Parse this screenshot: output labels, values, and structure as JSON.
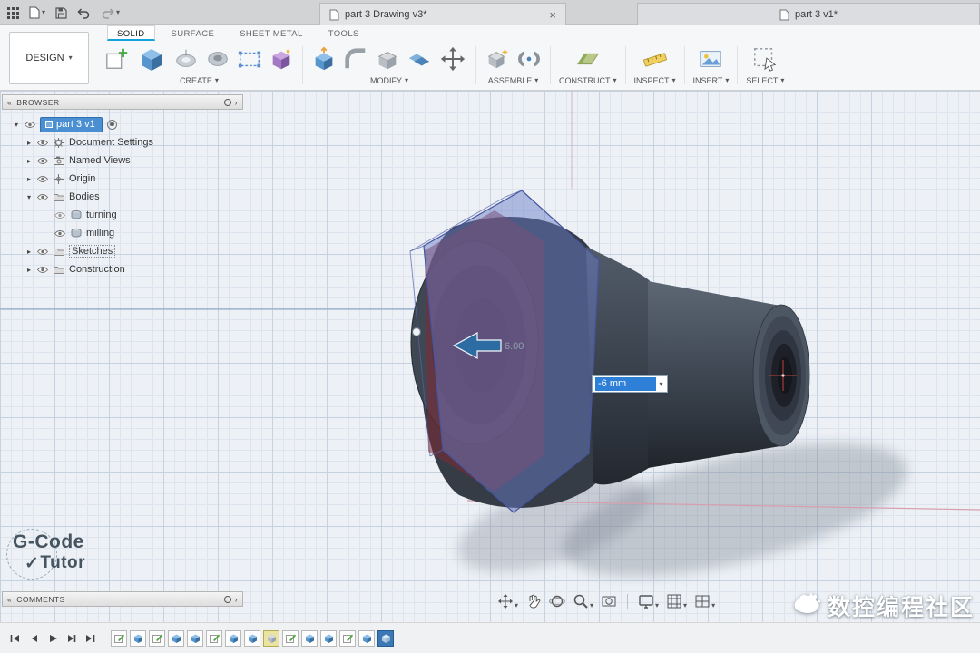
{
  "icons": {
    "caret_down": "▾",
    "tri_right": "▸",
    "tri_down": "▾",
    "close": "×",
    "chevrons_left": "«",
    "chevron_right": "›",
    "check": "✓"
  },
  "titlebar": {
    "tabs": [
      {
        "label": "part 3 Drawing v3*"
      },
      {
        "label": "part 3 v1*"
      }
    ]
  },
  "ribbon": {
    "design_menu": "DESIGN",
    "tabs": [
      {
        "label": "SOLID"
      },
      {
        "label": "SURFACE"
      },
      {
        "label": "SHEET METAL"
      },
      {
        "label": "TOOLS"
      }
    ],
    "groups": [
      {
        "label": "CREATE"
      },
      {
        "label": "MODIFY"
      },
      {
        "label": "ASSEMBLE"
      },
      {
        "label": "CONSTRUCT"
      },
      {
        "label": "INSPECT"
      },
      {
        "label": "INSERT"
      },
      {
        "label": "SELECT"
      }
    ]
  },
  "browser": {
    "header": "BROWSER",
    "root_label": "part 3 v1",
    "items": [
      {
        "label": "Document Settings"
      },
      {
        "label": "Named Views"
      },
      {
        "label": "Origin"
      },
      {
        "label": "Bodies"
      },
      {
        "label": "turning"
      },
      {
        "label": "milling"
      },
      {
        "label": "Sketches"
      },
      {
        "label": "Construction"
      }
    ]
  },
  "viewport": {
    "dimension_value": "-6 mm",
    "dimension_ghost": "6.00"
  },
  "comments": {
    "header": "COMMENTS"
  },
  "brand_watermark": {
    "line1": "G-Code",
    "line2": "Tutor"
  },
  "community_watermark": {
    "text": "数控编程社区"
  }
}
